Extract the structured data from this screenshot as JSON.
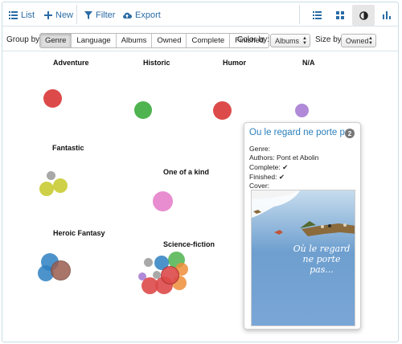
{
  "toolbar": {
    "list_label": "List",
    "new_label": "New",
    "filter_label": "Filter",
    "export_label": "Export",
    "views": [
      "table-view",
      "grid-view",
      "bubble-view",
      "chart-view"
    ],
    "active_view": "bubble-view"
  },
  "filterbar": {
    "group_by_label": "Group by:",
    "group_options": [
      "Genre",
      "Language",
      "Albums",
      "Owned",
      "Complete",
      "Finished"
    ],
    "group_active": "Genre",
    "color_by_label": "Color by:",
    "color_by_value": "Albums",
    "size_by_label": "Size by:",
    "size_by_value": "Owned"
  },
  "groups": [
    "Adventure",
    "Historic",
    "Humor",
    "N/A",
    "Fantastic",
    "One of a kind",
    "Heroic Fantasy",
    "Science-fiction"
  ],
  "colors": {
    "red": "#dd4a4a",
    "green": "#4fb34f",
    "purple": "#b08ad8",
    "olive": "#c9cc33",
    "gray": "#a8a8a8",
    "pink": "#e88dcf",
    "blue": "#2e80c2",
    "brown": "#9b5e50",
    "orange": "#ef8d3a",
    "link": "#2a7fbd"
  },
  "popover": {
    "title": "Ou le regard ne porte pas",
    "count": "2",
    "genre_label": "Genre:",
    "authors_label": "Authors:",
    "authors_value": "Pont et Abolin",
    "complete_label": "Complete:",
    "complete_value": "✔",
    "finished_label": "Finished:",
    "finished_value": "✔",
    "cover_label": "Cover:",
    "cover_text": "Où le regard ne porte pas..."
  }
}
